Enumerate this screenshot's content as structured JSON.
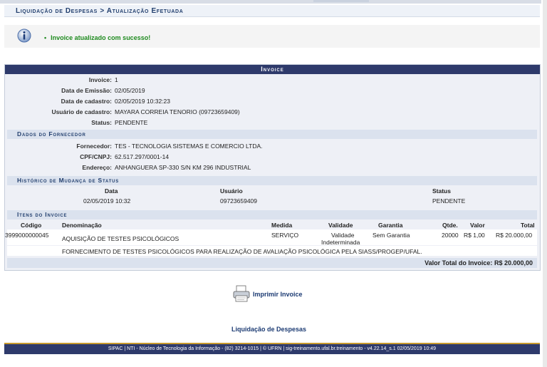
{
  "breadcrumb": "Liquidação de Despesas > Atualização Efetuada",
  "message": "Invoice atualizado com sucesso!",
  "panel": {
    "caption": "Invoice",
    "fields": [
      {
        "label": "Invoice:",
        "value": "1"
      },
      {
        "label": "Data de Emissão:",
        "value": "02/05/2019"
      },
      {
        "label": "Data de cadastro:",
        "value": "02/05/2019 10:32:23"
      },
      {
        "label": "Usuário de cadastro:",
        "value": "MAYARA CORREIA TENORIO (09723659409)"
      },
      {
        "label": "Status:",
        "value": "PENDENTE"
      }
    ],
    "supplier_title": "Dados do Fornecedor",
    "supplier": [
      {
        "label": "Fornecedor:",
        "value": "TES - TECNOLOGIA SISTEMAS E COMERCIO LTDA."
      },
      {
        "label": "CPF/CNPJ:",
        "value": "62.517.297/0001-14"
      },
      {
        "label": "Endereço:",
        "value": "ANHANGUERA SP-330 S/N KM 296 INDUSTRIAL"
      }
    ],
    "history_title": "Histórico de Mudança de Status",
    "history_headers": {
      "date": "Data",
      "user": "Usuário",
      "status": "Status"
    },
    "history_rows": [
      {
        "date": "02/05/2019 10:32",
        "user": "09723659409",
        "status": "PENDENTE"
      }
    ],
    "items_title": "Itens do Invoice",
    "items_headers": {
      "code": "Código",
      "name": "Denominação",
      "measure": "Medida",
      "validity": "Validade",
      "warranty": "Garantia",
      "qty": "Qtde.",
      "value": "Valor",
      "total": "Total"
    },
    "items": [
      {
        "code": "3999000000045",
        "name": "AQUISIÇÃO DE TESTES PSICOLÓGICOS",
        "measure": "SERVIÇO",
        "validity_1": "Validade",
        "validity_2": "Indeterminada",
        "warranty": "Sem Garantia",
        "qty": "20000",
        "value": "R$ 1,00",
        "total": "R$ 20.000,00",
        "description": "FORNECIMENTO DE TESTES PSICOLÓGICOS PARA REALIZAÇÃO DE AVALIAÇÃO PSICOLÓGICA PELA SIASS/PROGEP/UFAL."
      }
    ],
    "total_label": "Valor Total do Invoice:",
    "total_value": "R$ 20.000,00"
  },
  "actions": {
    "print_label": "Imprimir Invoice",
    "back_link": "Liquidação de Despesas"
  },
  "footer": "SIPAC | NTI - Núcleo de Tecnologia da Informação - (82) 3214-1015 | © UFRN | sig-treinamento.ufal.br.treinamento - v4.22.14_s.1 02/05/2019 10:49"
}
